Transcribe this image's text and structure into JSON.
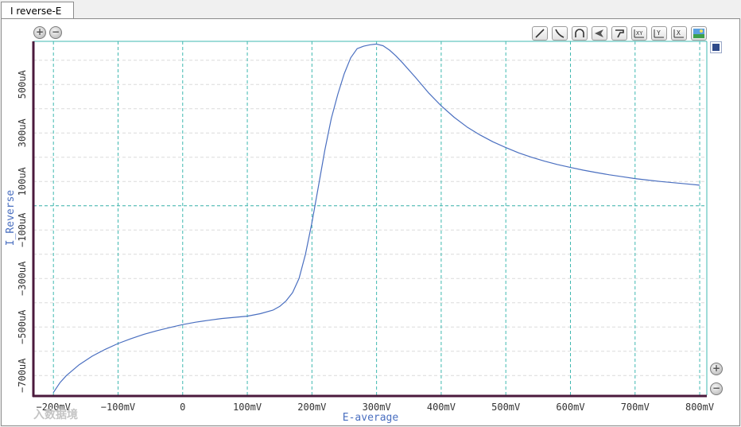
{
  "tab": {
    "title": "I reverse-E"
  },
  "zoom": {
    "plus": "+",
    "minus": "−"
  },
  "toolbar": {
    "icons": [
      "line-tool-icon",
      "curve-tool-icon",
      "arc-tool-icon",
      "cursor-tool-icon",
      "marker-tool-icon",
      "zoom-xy-icon",
      "zoom-y-icon",
      "zoom-x-icon",
      "image-export-icon"
    ],
    "labels": {
      "zoom_xy": "XY",
      "zoom_y": "Y",
      "zoom_x": "X"
    }
  },
  "colors": {
    "line": "#4a6fc0",
    "grid": "#3fb8b0",
    "axis_frame": "#4b1a3c",
    "label": "#4a6fc0",
    "legend": "#2f4a8a"
  },
  "watermark": "入数据境",
  "chart_data": {
    "type": "line",
    "xlabel": "E-average",
    "ylabel": "I_Reverse",
    "x_ticks": [
      -200,
      -100,
      0,
      100,
      200,
      300,
      400,
      500,
      600,
      700,
      800
    ],
    "x_tick_labels": [
      "−200mV",
      "−100mV",
      "0",
      "100mV",
      "200mV",
      "300mV",
      "400mV",
      "500mV",
      "600mV",
      "700mV",
      "800mV"
    ],
    "y_ticks": [
      -700,
      -500,
      -300,
      -100,
      100,
      300,
      500
    ],
    "y_tick_labels": [
      "−700uA",
      "−500uA",
      "−300uA",
      "−100uA",
      "100uA",
      "300uA",
      "500uA"
    ],
    "xlim": [
      -231,
      811
    ],
    "ylim": [
      -781,
      678
    ],
    "grid": true,
    "series": [
      {
        "x": [
          -200,
          -190,
          -180,
          -160,
          -140,
          -120,
          -100,
          -80,
          -60,
          -40,
          -20,
          0,
          20,
          40,
          60,
          80,
          100,
          120,
          140,
          150,
          160,
          170,
          180,
          190,
          200,
          210,
          220,
          230,
          240,
          250,
          260,
          270,
          280,
          290,
          300,
          310,
          320,
          330,
          340,
          360,
          380,
          400,
          420,
          440,
          460,
          480,
          500,
          520,
          540,
          560,
          580,
          600,
          620,
          640,
          660,
          680,
          700,
          720,
          740,
          760,
          780,
          800
        ],
        "y": [
          -770,
          -730,
          -700,
          -655,
          -620,
          -592,
          -568,
          -548,
          -530,
          -515,
          -502,
          -490,
          -480,
          -472,
          -465,
          -460,
          -455,
          -445,
          -430,
          -415,
          -392,
          -358,
          -300,
          -200,
          -70,
          80,
          230,
          360,
          460,
          545,
          610,
          648,
          658,
          664,
          667,
          660,
          642,
          618,
          590,
          530,
          467,
          412,
          365,
          325,
          292,
          264,
          240,
          218,
          200,
          184,
          170,
          158,
          147,
          137,
          128,
          120,
          112,
          106,
          100,
          95,
          90,
          85
        ]
      }
    ]
  }
}
